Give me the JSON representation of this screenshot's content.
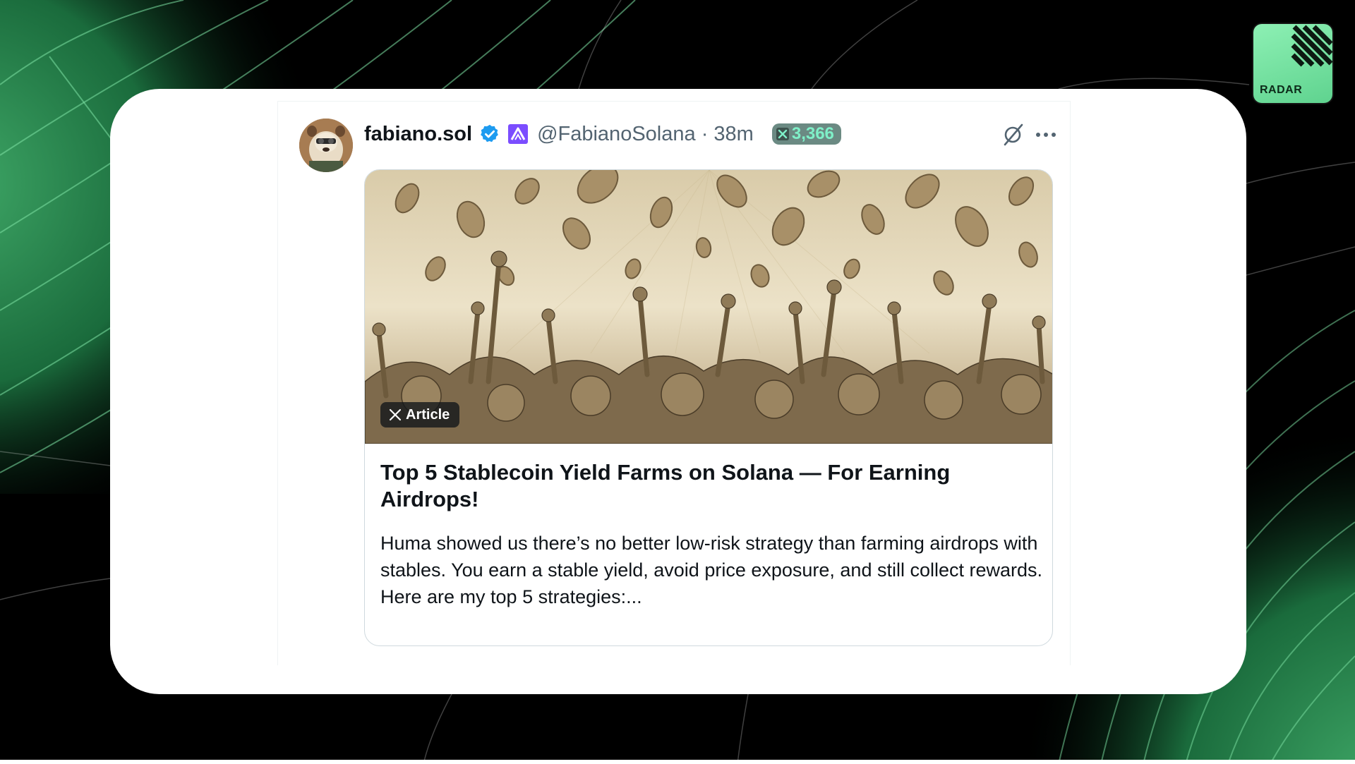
{
  "brand": {
    "badge_label": "RADAR",
    "badge_icon": "radar-stripes-logo",
    "accent_color": "#5fd38f"
  },
  "tweet": {
    "display_name": "fabiano.sol",
    "verified_icon": "verified-badge-icon",
    "affiliation_icon": "affiliate-logo-icon",
    "handle": "@FabianoSolana",
    "separator": "·",
    "time": "38m",
    "score": {
      "icon": "x-score-icon",
      "value": "3,366"
    },
    "actions": {
      "grok_icon": "grok-icon",
      "more_icon": "more-options-icon"
    },
    "article": {
      "tag_label": "Article",
      "tag_icon": "x-logo-icon",
      "title": "Top 5 Stablecoin Yield Farms on Solana — For Earning Airdrops!",
      "body_lines": [
        "Huma showed us there’s no better low-risk strategy than farming airdrops with stables. You earn a stable yield, avoid price exposure, and still collect rewards.",
        "Here are my top 5 strategies:..."
      ]
    }
  }
}
